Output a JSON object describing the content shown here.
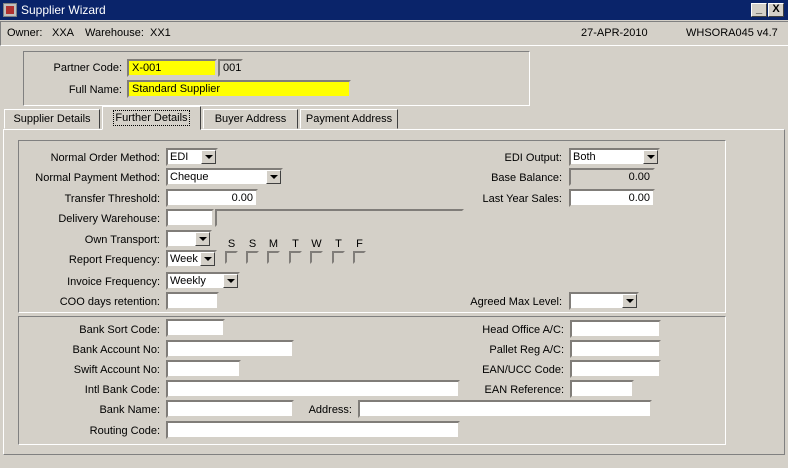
{
  "window": {
    "title": "Supplier Wizard",
    "icon": "app-icon",
    "buttons": [
      "_",
      "X"
    ]
  },
  "info": {
    "owner_label": "Owner:",
    "owner_value": "XXA",
    "warehouse_label": "Warehouse:",
    "warehouse_value": "XX1",
    "date": "27-APR-2010",
    "app": "WHSORA045",
    "version": "v4.7"
  },
  "header": {
    "partner_code_label": "Partner Code:",
    "partner_code": "X-001",
    "partner_code_suffix": "001",
    "full_name_label": "Full Name:",
    "full_name": "Standard Supplier"
  },
  "tabs": [
    {
      "label": "Supplier Details",
      "active": false
    },
    {
      "label": "Further Details",
      "active": true
    },
    {
      "label": "Buyer Address",
      "active": false
    },
    {
      "label": "Payment Address",
      "active": false
    }
  ],
  "further": {
    "normal_order_method_label": "Normal Order Method:",
    "normal_order_method": "EDI",
    "normal_payment_method_label": "Normal Payment Method:",
    "normal_payment_method": "Cheque",
    "transfer_threshold_label": "Transfer Threshold:",
    "transfer_threshold": "0.00",
    "delivery_warehouse_label": "Delivery Warehouse:",
    "delivery_warehouse": "",
    "delivery_warehouse_desc": "",
    "own_transport_label": "Own Transport:",
    "own_transport": "",
    "report_frequency_label": "Report Frequency:",
    "report_frequency": "Week",
    "days": [
      "S",
      "S",
      "M",
      "T",
      "W",
      "T",
      "F"
    ],
    "invoice_frequency_label": "Invoice Frequency:",
    "invoice_frequency": "Weekly",
    "coo_days_label": "COO days retention:",
    "coo_days": "",
    "edi_output_label": "EDI Output:",
    "edi_output": "Both",
    "base_balance_label": "Base Balance:",
    "base_balance": "0.00",
    "last_year_sales_label": "Last Year Sales:",
    "last_year_sales": "0.00",
    "agreed_max_level_label": "Agreed Max Level:",
    "agreed_max_level": ""
  },
  "bank": {
    "bank_sort_code_label": "Bank Sort Code:",
    "bank_sort_code": "",
    "bank_account_no_label": "Bank Account No:",
    "bank_account_no": "",
    "swift_account_no_label": "Swift Account No:",
    "swift_account_no": "",
    "intl_bank_code_label": "Intl Bank Code:",
    "intl_bank_code": "",
    "bank_name_label": "Bank Name:",
    "bank_name": "",
    "address_label": "Address:",
    "address": "",
    "routing_code_label": "Routing Code:",
    "routing_code": "",
    "head_office_ac_label": "Head Office A/C:",
    "head_office_ac": "",
    "pallet_reg_ac_label": "Pallet Reg A/C:",
    "pallet_reg_ac": "",
    "ean_ucc_code_label": "EAN/UCC Code:",
    "ean_ucc_code": "",
    "ean_reference_label": "EAN Reference:",
    "ean_reference": ""
  },
  "colors": {
    "titlebar": "#0a246a",
    "face": "#d4d0c8",
    "highlight_field": "#ffff00"
  }
}
